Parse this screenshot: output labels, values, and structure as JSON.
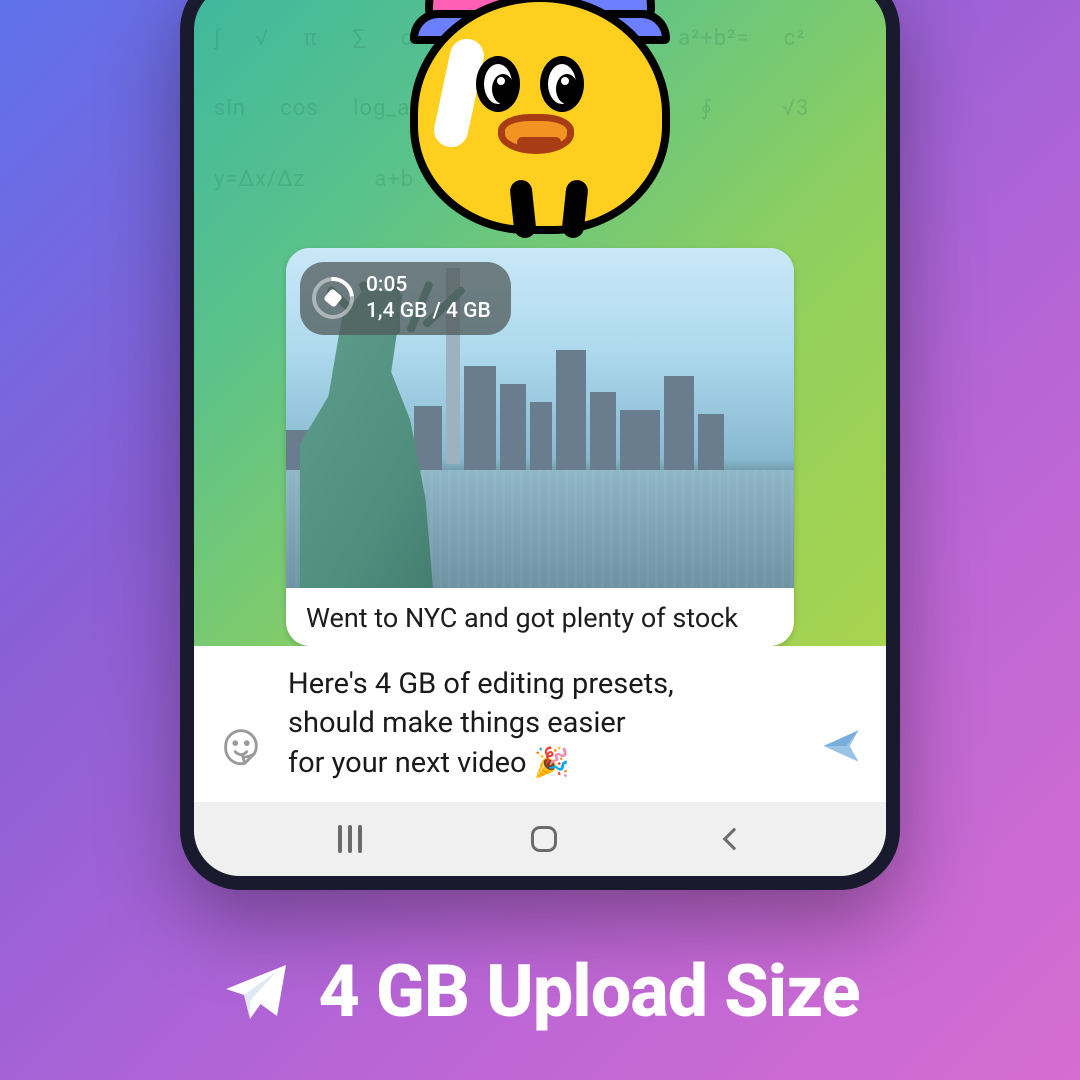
{
  "upload": {
    "time": "0:05",
    "progress": "1,4 GB / 4 GB"
  },
  "bubble": {
    "caption": "Went to NYC and got plenty of stock"
  },
  "composer": {
    "text": "Here's 4 GB of editing presets,\nshould make things easier\nfor your next video 🎉"
  },
  "promo": {
    "title": "4 GB Upload Size"
  }
}
